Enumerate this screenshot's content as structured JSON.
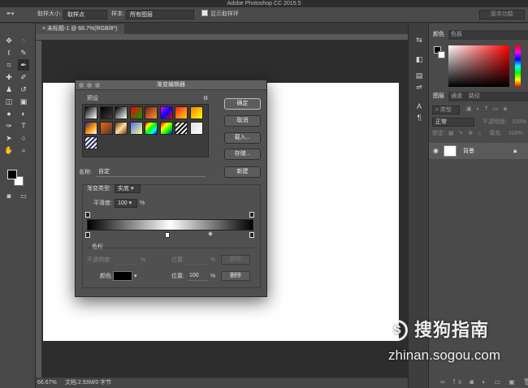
{
  "app": {
    "window_title": "Adobe Photoshop CC 2015.5"
  },
  "options_bar": {
    "sample_size_label": "取样大小:",
    "sample_size_value": "取样点",
    "sample_label": "样本:",
    "sample_value": "所有图层",
    "show_ring_label": "显示取样环",
    "workspace": "基本功能"
  },
  "document_tab": {
    "title": "未标题-1 @ 66.7%(RGB/8*)"
  },
  "status_bar": {
    "zoom": "66.67%",
    "doc_info": "文档:2.93M/0 字节"
  },
  "tools": [
    {
      "name": "move-tool",
      "glyph": "✥"
    },
    {
      "name": "marquee-tool",
      "glyph": "◌"
    },
    {
      "name": "lasso-tool",
      "glyph": "ℓ"
    },
    {
      "name": "quick-select-tool",
      "glyph": "✎"
    },
    {
      "name": "crop-tool",
      "glyph": "⌗"
    },
    {
      "name": "eyedropper-tool",
      "glyph": "✒"
    },
    {
      "name": "healing-tool",
      "glyph": "✚"
    },
    {
      "name": "brush-tool",
      "glyph": "✐"
    },
    {
      "name": "stamp-tool",
      "glyph": "♟"
    },
    {
      "name": "history-brush-tool",
      "glyph": "↺"
    },
    {
      "name": "eraser-tool",
      "glyph": "◫"
    },
    {
      "name": "gradient-tool",
      "glyph": "▣"
    },
    {
      "name": "blur-tool",
      "glyph": "●"
    },
    {
      "name": "dodge-tool",
      "glyph": "◐"
    },
    {
      "name": "pen-tool",
      "glyph": "✑"
    },
    {
      "name": "type-tool",
      "glyph": "T"
    },
    {
      "name": "path-select-tool",
      "glyph": "➤"
    },
    {
      "name": "shape-tool",
      "glyph": "○"
    },
    {
      "name": "hand-tool",
      "glyph": "✋"
    },
    {
      "name": "zoom-tool",
      "glyph": "⌕"
    }
  ],
  "color_panel": {
    "tabs": [
      "颜色",
      "色板"
    ]
  },
  "layers_panel": {
    "tabs": [
      "图层",
      "通道",
      "路径"
    ],
    "kind_label": "类型",
    "blend_mode": "正常",
    "opacity_label": "不透明度:",
    "opacity_value": "100%",
    "lock_label": "锁定:",
    "fill_label": "填充:",
    "fill_value": "100%",
    "layer_name": "背景"
  },
  "gradient_editor": {
    "title": "渐变编辑器",
    "presets_label": "预设",
    "buttons": {
      "ok": "确定",
      "cancel": "取消",
      "load": "载入...",
      "save": "存储...",
      "new": "新建"
    },
    "name_label": "名称:",
    "name_value": "自定",
    "type_label": "渐变类型:",
    "type_value": "实底",
    "smoothness_label": "平滑度:",
    "smoothness_value": "100",
    "percent": "%",
    "stops_label": "色标",
    "opacity_label": "不透明度:",
    "opacity_location_label": "位置:",
    "opacity_delete": "删除",
    "color_label": "颜色:",
    "color_location_label": "位置:",
    "color_location_value": "100",
    "color_delete": "删除",
    "presets": [
      {
        "swatch": "linear-gradient(135deg,#000,#fff)"
      },
      {
        "swatch": "linear-gradient(135deg,#000,rgba(0,0,0,0))"
      },
      {
        "swatch": "linear-gradient(135deg,#000,#fff)"
      },
      {
        "swatch": "linear-gradient(135deg,#ff0000,#00a000)"
      },
      {
        "swatch": "linear-gradient(135deg,#7a1a1a,#ff9a30)"
      },
      {
        "swatch": "linear-gradient(135deg,#ff00ff,#0000ff,#ff0000)"
      },
      {
        "swatch": "linear-gradient(135deg,#ff2020,#ffd000)"
      },
      {
        "swatch": "linear-gradient(135deg,#ff8000,#ffff00)"
      },
      {
        "swatch": "linear-gradient(135deg,#1a2aa0,#ff9000,#ffffff)"
      },
      {
        "swatch": "linear-gradient(135deg,#ff6000,rgba(0,0,0,0))"
      },
      {
        "swatch": "linear-gradient(135deg,#6a3010,#ffe0a0,#6a3010)"
      },
      {
        "swatch": "linear-gradient(135deg,#5070ff,#ffff80)"
      },
      {
        "swatch": "linear-gradient(135deg,#ff0000,#ffff00,#00ff00,#00ffff,#0000ff)"
      },
      {
        "swatch": "linear-gradient(135deg,#ff0000,#ffff00,#00ff00,#0000ff)"
      },
      {
        "swatch": "repeating-linear-gradient(135deg,#111 0 2px,#eee 2px 4px)"
      },
      {
        "swatch": "linear-gradient(135deg,#e0e0e0,#fff)"
      },
      {
        "swatch": "repeating-linear-gradient(135deg,#2a3060 0 2px,#f0f0f0 2px 4px)"
      }
    ]
  }
}
